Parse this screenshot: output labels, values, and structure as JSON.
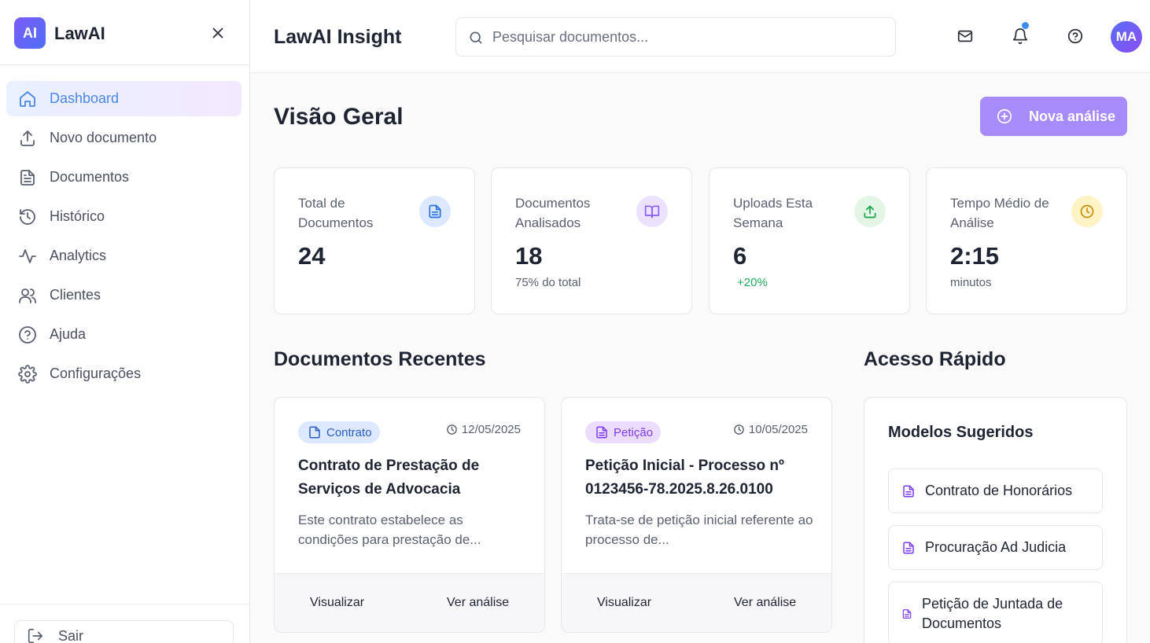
{
  "sidebar": {
    "logo_mark": "AI",
    "brand": "LawAI",
    "nav": [
      {
        "label": "Dashboard"
      },
      {
        "label": "Novo documento"
      },
      {
        "label": "Documentos"
      },
      {
        "label": "Histórico"
      },
      {
        "label": "Analytics"
      },
      {
        "label": "Clientes"
      },
      {
        "label": "Ajuda"
      },
      {
        "label": "Configurações"
      }
    ],
    "logout_label": "Sair"
  },
  "header": {
    "title": "LawAI Insight",
    "search_placeholder": "Pesquisar documentos...",
    "avatar_initials": "MA"
  },
  "main": {
    "title": "Visão Geral",
    "new_analysis_label": "Nova análise",
    "stats": [
      {
        "label": "Total de Documentos",
        "value": "24",
        "sub": ""
      },
      {
        "label": "Documentos Analisados",
        "value": "18",
        "sub": "75% do total"
      },
      {
        "label": "Uploads Esta Semana",
        "value": "6",
        "sub": "+20%"
      },
      {
        "label": "Tempo Médio de Análise",
        "value": "2:15",
        "sub": "minutos"
      }
    ],
    "recent_title": "Documentos Recentes",
    "recent_docs": [
      {
        "tag": "Contrato",
        "date": "12/05/2025",
        "title": "Contrato de Prestação de Serviços de Advocacia",
        "description": "Este contrato estabelece as condições para prestação de...",
        "view_label": "Visualizar",
        "analysis_label": "Ver análise"
      },
      {
        "tag": "Petição",
        "date": "10/05/2025",
        "title": "Petição Inicial - Processo nº 0123456-78.2025.8.26.0100",
        "description": "Trata-se de petição inicial referente ao processo de...",
        "view_label": "Visualizar",
        "analysis_label": "Ver análise"
      }
    ],
    "quick_title": "Acesso Rápido",
    "quick_card": {
      "title": "Modelos Sugeridos",
      "templates": [
        {
          "label": "Contrato de Honorários"
        },
        {
          "label": "Procuração Ad Judicia"
        },
        {
          "label": "Petição de Juntada de Documentos"
        }
      ]
    }
  },
  "colors": {
    "accent": "#4a86e8",
    "primary_button": "#a78bfa",
    "success": "#22a85a",
    "notification_dot": "#3b8df0"
  }
}
